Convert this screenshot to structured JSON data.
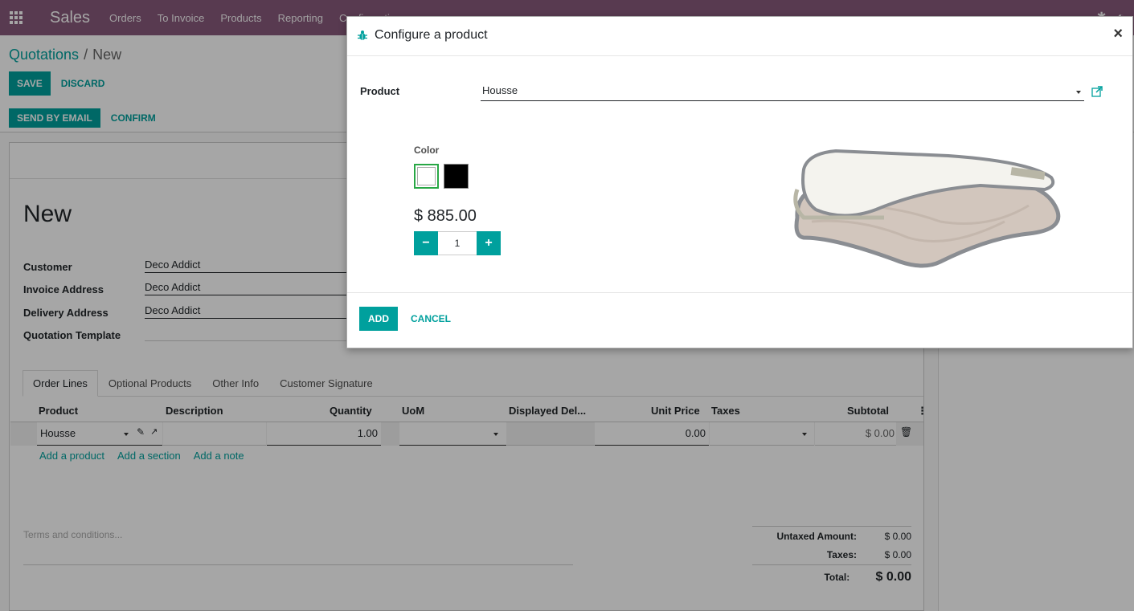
{
  "nav": {
    "app": "Sales",
    "menu": [
      "Orders",
      "To Invoice",
      "Products",
      "Reporting",
      "Configuration"
    ]
  },
  "breadcrumb": {
    "parent": "Quotations",
    "current": "New"
  },
  "cp_buttons": {
    "save": "SAVE",
    "discard": "DISCARD"
  },
  "status_buttons": {
    "send_email": "SEND BY EMAIL",
    "confirm": "CONFIRM"
  },
  "record": {
    "title": "New",
    "fields": [
      {
        "label": "Customer",
        "value": "Deco Addict"
      },
      {
        "label": "Invoice Address",
        "value": "Deco Addict"
      },
      {
        "label": "Delivery Address",
        "value": "Deco Addict"
      },
      {
        "label": "Quotation Template",
        "value": ""
      }
    ]
  },
  "tabs": [
    "Order Lines",
    "Optional Products",
    "Other Info",
    "Customer Signature"
  ],
  "table": {
    "headers": [
      "Product",
      "Description",
      "Quantity",
      "UoM",
      "Displayed Del...",
      "Unit Price",
      "Taxes",
      "Subtotal"
    ],
    "row": {
      "product": "Housse",
      "description": "",
      "quantity": "1.00",
      "uom": "",
      "unit_price": "0.00",
      "taxes": "",
      "subtotal": "$ 0.00"
    }
  },
  "add_links": [
    "Add a product",
    "Add a section",
    "Add a note"
  ],
  "terms_placeholder": "Terms and conditions...",
  "totals": {
    "untaxed_label": "Untaxed Amount:",
    "untaxed": "$ 0.00",
    "taxes_label": "Taxes:",
    "taxes": "$ 0.00",
    "total_label": "Total:",
    "total": "$ 0.00"
  },
  "modal": {
    "title": "Configure a product",
    "product_label": "Product",
    "product_value": "Housse",
    "color_label": "Color",
    "colors": [
      "#ffffff",
      "#000000"
    ],
    "price": "$ 885.00",
    "quantity": "1",
    "add": "ADD",
    "cancel": "CANCEL"
  },
  "accent": "#00a09d",
  "brand_color": "#875a7b"
}
